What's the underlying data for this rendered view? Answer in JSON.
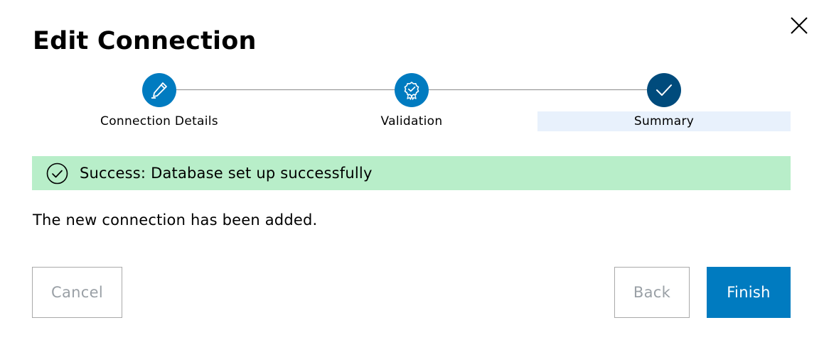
{
  "dialog": {
    "title": "Edit Connection",
    "close_icon": "close-icon"
  },
  "stepper": {
    "steps": [
      {
        "label": "Connection Details",
        "icon": "pencil-icon",
        "state": "complete"
      },
      {
        "label": "Validation",
        "icon": "badge-check-icon",
        "state": "complete"
      },
      {
        "label": "Summary",
        "icon": "checkmark-icon",
        "state": "active"
      }
    ]
  },
  "banner": {
    "icon": "check-circle-icon",
    "message": "Success: Database set up successfully",
    "color": "#b8eec9"
  },
  "body": {
    "message": "The new connection has been added."
  },
  "buttons": {
    "cancel_label": "Cancel",
    "back_label": "Back",
    "finish_label": "Finish"
  },
  "colors": {
    "primary": "#007bc0",
    "step_done": "#004b7c",
    "active_step_bg": "#e8f1fc"
  }
}
